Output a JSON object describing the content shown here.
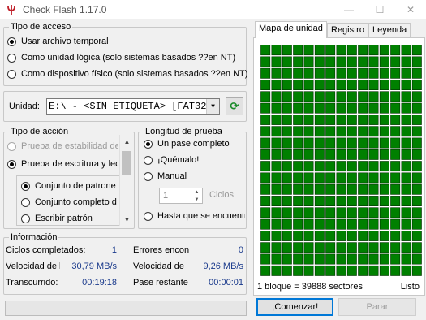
{
  "window": {
    "title": "Check Flash 1.17.0"
  },
  "access_type": {
    "title": "Tipo de acceso",
    "options": [
      {
        "label": "Usar archivo temporal",
        "checked": true
      },
      {
        "label": "Como unidad lógica (solo sistemas basados ??en NT)",
        "checked": false
      },
      {
        "label": "Como dispositivo físico (solo sistemas basados ??en NT)",
        "checked": false
      }
    ]
  },
  "unit": {
    "label": "Unidad:",
    "value": "E:\\ - <SIN ETIQUETA> [FAT32]"
  },
  "action_type": {
    "title": "Tipo de acción",
    "options": [
      {
        "label": "Prueba de estabilidad de",
        "checked": false,
        "disabled": true
      },
      {
        "label": "Prueba de escritura y lec",
        "checked": true,
        "disabled": false
      }
    ],
    "patterns": [
      {
        "label": "Conjunto de patrone",
        "checked": true
      },
      {
        "label": "Conjunto completo d",
        "checked": false
      },
      {
        "label": "Escribir patrón",
        "checked": false
      }
    ]
  },
  "test_length": {
    "title": "Longitud de prueba",
    "options": [
      {
        "label": "Un pase completo",
        "checked": true
      },
      {
        "label": "¡Quémalo!",
        "checked": false
      },
      {
        "label": "Manual",
        "checked": false
      },
      {
        "label": "Hasta que se encuentre",
        "checked": false
      }
    ],
    "cycles_value": "1",
    "cycles_label": "Ciclos"
  },
  "info": {
    "title": "Información",
    "rows": [
      {
        "left_label": "Ciclos completados:",
        "left_value": "1",
        "right_label": "Errores encon",
        "right_value": "0"
      },
      {
        "left_label": "Velocidad de l",
        "left_value": "30,79 MB/s",
        "right_label": "Velocidad de e",
        "right_value": "9,26 MB/s"
      },
      {
        "left_label": "Transcurrido:",
        "left_value": "00:19:18",
        "right_label": "Pase restante",
        "right_value": "00:00:01"
      }
    ]
  },
  "tabs": [
    "Mapa de unidad",
    "Registro",
    "Leyenda"
  ],
  "map": {
    "block_info": "1 bloque = 39888 sectores",
    "view_mode": "Listo",
    "block_color": "#008000",
    "rows": 20,
    "cols": 15
  },
  "progress": {
    "fraction": 0.0
  },
  "buttons": {
    "start": "¡Comenzar!",
    "stop": "Parar"
  }
}
